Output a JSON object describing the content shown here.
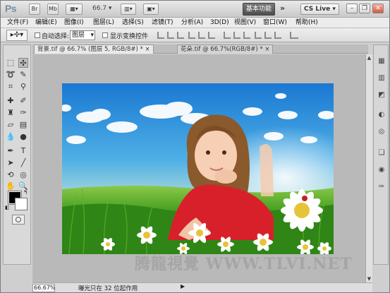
{
  "titlebar": {
    "logo": "Ps",
    "btn_br": "Br",
    "btn_mb": "Mb",
    "zoom": "66.7",
    "workspace": "基本功能",
    "more": "»",
    "cslive": "CS Live",
    "cslive_arrow": "▾",
    "minimize": "–",
    "restore": "❐",
    "close": "✕"
  },
  "menu": {
    "items": [
      "文件(F)",
      "编辑(E)",
      "图像(I)",
      "图层(L)",
      "选择(S)",
      "滤镜(T)",
      "分析(A)",
      "3D(D)",
      "视图(V)",
      "窗口(W)",
      "帮助(H)"
    ]
  },
  "options": {
    "auto_select_label": "自动选择:",
    "auto_select_value": "图层",
    "show_transform_label": "显示变换控件"
  },
  "tabs": [
    {
      "label": "背景.tif @ 66.7% (图层 5, RGB/8#) *",
      "close": "×"
    },
    {
      "label": "花朵.tif @ 66.7%(RGB/8#) *",
      "close": "×"
    }
  ],
  "status": {
    "zoom": "66.67%",
    "text": "曝光只在 32 位起作用",
    "arrow": "▶"
  },
  "scroll": {
    "up": "▲",
    "down": "▼"
  },
  "watermark": "腾龍視覺 WWW.TLVI.NET",
  "colors": {
    "sky_top": "#1f7fd6",
    "sky_bottom": "#e8f1a8",
    "grass": "#3f9a1c",
    "dress": "#d8202a"
  }
}
